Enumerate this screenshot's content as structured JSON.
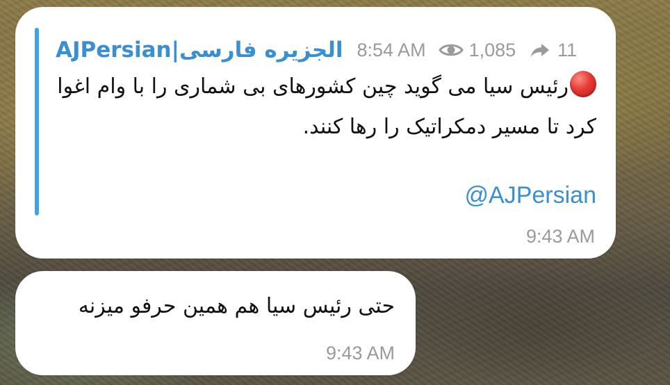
{
  "colors": {
    "accent": "#3a8fd1",
    "quote_bar": "#3fa2e3",
    "meta_gray": "#9a9a9a",
    "bubble": "#ffffff",
    "text": "#111111",
    "red_circle": "#e53935"
  },
  "forwarded_message": {
    "channel_name": "AJPersian|الجزیره فارسی",
    "post_time": "8:54 AM",
    "views_icon": "eye-icon",
    "views": "1,085",
    "shares_icon": "share-arrow-icon",
    "shares": "11",
    "emoji_icon": "red-circle-icon",
    "text": "رئیس سیا می گوید چین کشورهای بی شماری را با وام اغوا کرد تا مسیر دمکراتیک را رها کنند.",
    "mention": "@AJPersian",
    "time": "9:43 AM"
  },
  "reply_message": {
    "text": "حتی رئیس سیا هم همین حرفو میزنه",
    "time": "9:43 AM"
  }
}
